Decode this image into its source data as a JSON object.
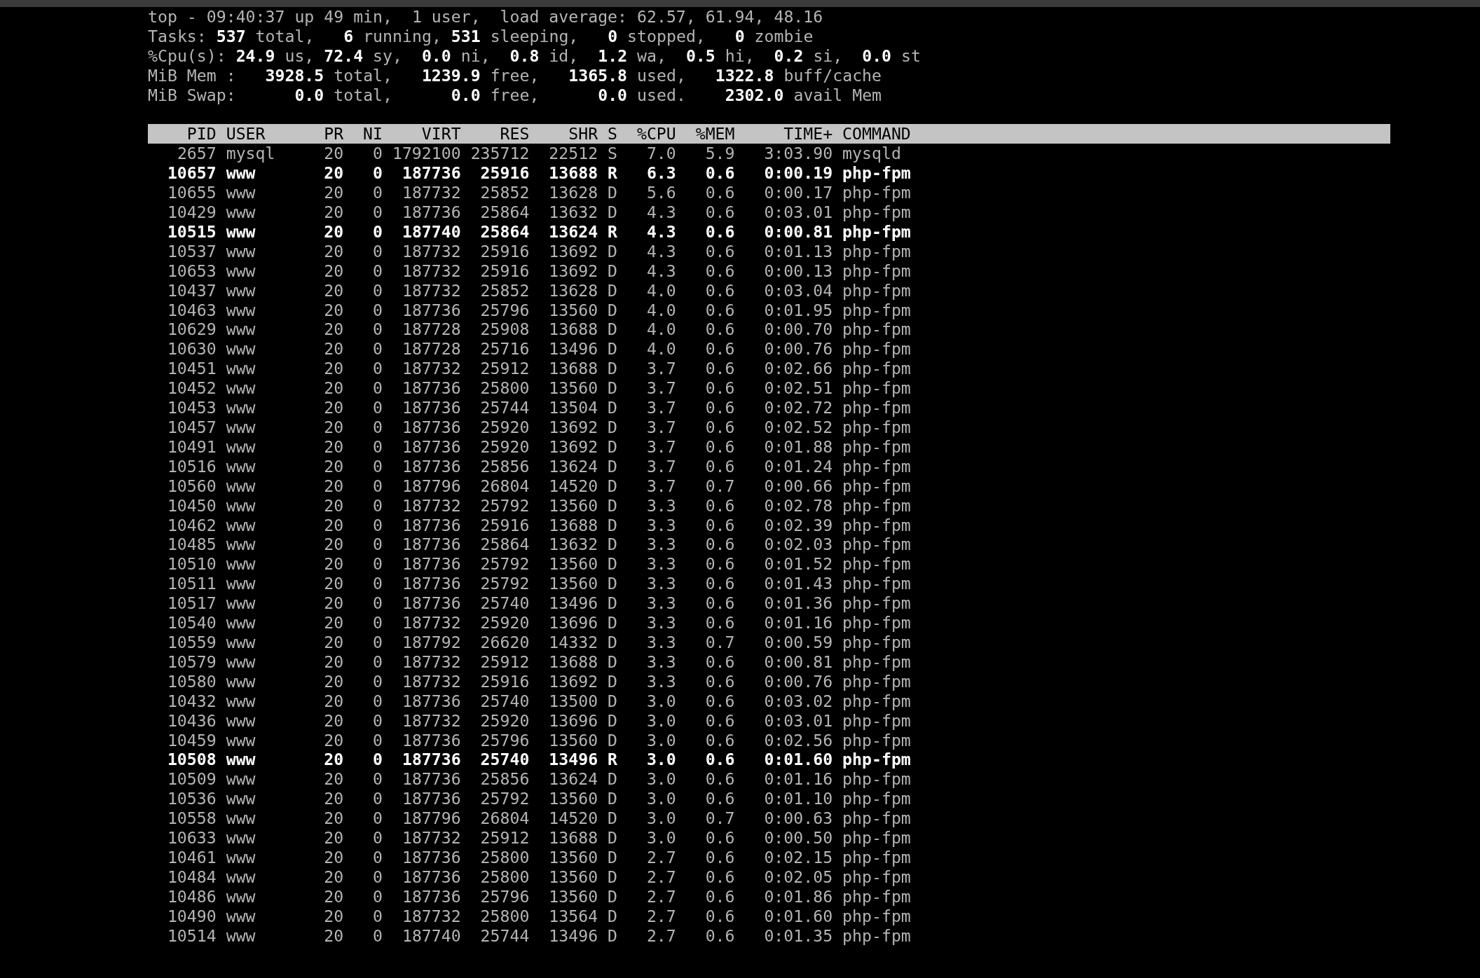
{
  "summary": [
    "top - 09:40:37 up 49 min,  1 user,  load average: 62.57, 61.94, 48.16",
    "Tasks: **537** total,   **6** running, **531** sleeping,   **0** stopped,   **0** zombie",
    "%Cpu(s): **24.9** us, **72.4** sy,  **0.0** ni,  **0.8** id,  **1.2** wa,  **0.5** hi,  **0.2** si,  **0.0** st",
    "MiB Mem :   **3928.5** total,   **1239.9** free,   **1365.8** used,   **1322.8** buff/cache",
    "MiB Swap:      **0.0** total,      **0.0** free,      **0.0** used.    **2302.0** avail Mem"
  ],
  "columns": [
    "PID",
    "USER",
    "PR",
    "NI",
    "VIRT",
    "RES",
    "SHR",
    "S",
    "%CPU",
    "%MEM",
    "TIME+",
    "COMMAND"
  ],
  "rows": [
    {
      "cells": [
        "2657",
        "mysql",
        "20",
        "0",
        "1792100",
        "235712",
        "22512",
        "S",
        "7.0",
        "5.9",
        "3:03.90",
        "mysqld"
      ],
      "running": false
    },
    {
      "cells": [
        "10657",
        "www",
        "20",
        "0",
        "187736",
        "25916",
        "13688",
        "R",
        "6.3",
        "0.6",
        "0:00.19",
        "php-fpm"
      ],
      "running": true
    },
    {
      "cells": [
        "10655",
        "www",
        "20",
        "0",
        "187732",
        "25852",
        "13628",
        "D",
        "5.6",
        "0.6",
        "0:00.17",
        "php-fpm"
      ],
      "running": false
    },
    {
      "cells": [
        "10429",
        "www",
        "20",
        "0",
        "187736",
        "25864",
        "13632",
        "D",
        "4.3",
        "0.6",
        "0:03.01",
        "php-fpm"
      ],
      "running": false
    },
    {
      "cells": [
        "10515",
        "www",
        "20",
        "0",
        "187740",
        "25864",
        "13624",
        "R",
        "4.3",
        "0.6",
        "0:00.81",
        "php-fpm"
      ],
      "running": true
    },
    {
      "cells": [
        "10537",
        "www",
        "20",
        "0",
        "187732",
        "25916",
        "13692",
        "D",
        "4.3",
        "0.6",
        "0:01.13",
        "php-fpm"
      ],
      "running": false
    },
    {
      "cells": [
        "10653",
        "www",
        "20",
        "0",
        "187732",
        "25916",
        "13692",
        "D",
        "4.3",
        "0.6",
        "0:00.13",
        "php-fpm"
      ],
      "running": false
    },
    {
      "cells": [
        "10437",
        "www",
        "20",
        "0",
        "187732",
        "25852",
        "13628",
        "D",
        "4.0",
        "0.6",
        "0:03.04",
        "php-fpm"
      ],
      "running": false
    },
    {
      "cells": [
        "10463",
        "www",
        "20",
        "0",
        "187736",
        "25796",
        "13560",
        "D",
        "4.0",
        "0.6",
        "0:01.95",
        "php-fpm"
      ],
      "running": false
    },
    {
      "cells": [
        "10629",
        "www",
        "20",
        "0",
        "187728",
        "25908",
        "13688",
        "D",
        "4.0",
        "0.6",
        "0:00.70",
        "php-fpm"
      ],
      "running": false
    },
    {
      "cells": [
        "10630",
        "www",
        "20",
        "0",
        "187728",
        "25716",
        "13496",
        "D",
        "4.0",
        "0.6",
        "0:00.76",
        "php-fpm"
      ],
      "running": false
    },
    {
      "cells": [
        "10451",
        "www",
        "20",
        "0",
        "187732",
        "25912",
        "13688",
        "D",
        "3.7",
        "0.6",
        "0:02.66",
        "php-fpm"
      ],
      "running": false
    },
    {
      "cells": [
        "10452",
        "www",
        "20",
        "0",
        "187736",
        "25800",
        "13560",
        "D",
        "3.7",
        "0.6",
        "0:02.51",
        "php-fpm"
      ],
      "running": false
    },
    {
      "cells": [
        "10453",
        "www",
        "20",
        "0",
        "187736",
        "25744",
        "13504",
        "D",
        "3.7",
        "0.6",
        "0:02.72",
        "php-fpm"
      ],
      "running": false
    },
    {
      "cells": [
        "10457",
        "www",
        "20",
        "0",
        "187736",
        "25920",
        "13692",
        "D",
        "3.7",
        "0.6",
        "0:02.52",
        "php-fpm"
      ],
      "running": false
    },
    {
      "cells": [
        "10491",
        "www",
        "20",
        "0",
        "187736",
        "25920",
        "13692",
        "D",
        "3.7",
        "0.6",
        "0:01.88",
        "php-fpm"
      ],
      "running": false
    },
    {
      "cells": [
        "10516",
        "www",
        "20",
        "0",
        "187736",
        "25856",
        "13624",
        "D",
        "3.7",
        "0.6",
        "0:01.24",
        "php-fpm"
      ],
      "running": false
    },
    {
      "cells": [
        "10560",
        "www",
        "20",
        "0",
        "187796",
        "26804",
        "14520",
        "D",
        "3.7",
        "0.7",
        "0:00.66",
        "php-fpm"
      ],
      "running": false
    },
    {
      "cells": [
        "10450",
        "www",
        "20",
        "0",
        "187732",
        "25792",
        "13560",
        "D",
        "3.3",
        "0.6",
        "0:02.78",
        "php-fpm"
      ],
      "running": false
    },
    {
      "cells": [
        "10462",
        "www",
        "20",
        "0",
        "187736",
        "25916",
        "13688",
        "D",
        "3.3",
        "0.6",
        "0:02.39",
        "php-fpm"
      ],
      "running": false
    },
    {
      "cells": [
        "10485",
        "www",
        "20",
        "0",
        "187736",
        "25864",
        "13632",
        "D",
        "3.3",
        "0.6",
        "0:02.03",
        "php-fpm"
      ],
      "running": false
    },
    {
      "cells": [
        "10510",
        "www",
        "20",
        "0",
        "187736",
        "25792",
        "13560",
        "D",
        "3.3",
        "0.6",
        "0:01.52",
        "php-fpm"
      ],
      "running": false
    },
    {
      "cells": [
        "10511",
        "www",
        "20",
        "0",
        "187736",
        "25792",
        "13560",
        "D",
        "3.3",
        "0.6",
        "0:01.43",
        "php-fpm"
      ],
      "running": false
    },
    {
      "cells": [
        "10517",
        "www",
        "20",
        "0",
        "187736",
        "25740",
        "13496",
        "D",
        "3.3",
        "0.6",
        "0:01.36",
        "php-fpm"
      ],
      "running": false
    },
    {
      "cells": [
        "10540",
        "www",
        "20",
        "0",
        "187732",
        "25920",
        "13696",
        "D",
        "3.3",
        "0.6",
        "0:01.16",
        "php-fpm"
      ],
      "running": false
    },
    {
      "cells": [
        "10559",
        "www",
        "20",
        "0",
        "187792",
        "26620",
        "14332",
        "D",
        "3.3",
        "0.7",
        "0:00.59",
        "php-fpm"
      ],
      "running": false
    },
    {
      "cells": [
        "10579",
        "www",
        "20",
        "0",
        "187732",
        "25912",
        "13688",
        "D",
        "3.3",
        "0.6",
        "0:00.81",
        "php-fpm"
      ],
      "running": false
    },
    {
      "cells": [
        "10580",
        "www",
        "20",
        "0",
        "187732",
        "25916",
        "13692",
        "D",
        "3.3",
        "0.6",
        "0:00.76",
        "php-fpm"
      ],
      "running": false
    },
    {
      "cells": [
        "10432",
        "www",
        "20",
        "0",
        "187736",
        "25740",
        "13500",
        "D",
        "3.0",
        "0.6",
        "0:03.02",
        "php-fpm"
      ],
      "running": false
    },
    {
      "cells": [
        "10436",
        "www",
        "20",
        "0",
        "187732",
        "25920",
        "13696",
        "D",
        "3.0",
        "0.6",
        "0:03.01",
        "php-fpm"
      ],
      "running": false
    },
    {
      "cells": [
        "10459",
        "www",
        "20",
        "0",
        "187736",
        "25796",
        "13560",
        "D",
        "3.0",
        "0.6",
        "0:02.56",
        "php-fpm"
      ],
      "running": false
    },
    {
      "cells": [
        "10508",
        "www",
        "20",
        "0",
        "187736",
        "25740",
        "13496",
        "R",
        "3.0",
        "0.6",
        "0:01.60",
        "php-fpm"
      ],
      "running": true
    },
    {
      "cells": [
        "10509",
        "www",
        "20",
        "0",
        "187736",
        "25856",
        "13624",
        "D",
        "3.0",
        "0.6",
        "0:01.16",
        "php-fpm"
      ],
      "running": false
    },
    {
      "cells": [
        "10536",
        "www",
        "20",
        "0",
        "187736",
        "25792",
        "13560",
        "D",
        "3.0",
        "0.6",
        "0:01.10",
        "php-fpm"
      ],
      "running": false
    },
    {
      "cells": [
        "10558",
        "www",
        "20",
        "0",
        "187796",
        "26804",
        "14520",
        "D",
        "3.0",
        "0.7",
        "0:00.63",
        "php-fpm"
      ],
      "running": false
    },
    {
      "cells": [
        "10633",
        "www",
        "20",
        "0",
        "187732",
        "25912",
        "13688",
        "D",
        "3.0",
        "0.6",
        "0:00.50",
        "php-fpm"
      ],
      "running": false
    },
    {
      "cells": [
        "10461",
        "www",
        "20",
        "0",
        "187736",
        "25800",
        "13560",
        "D",
        "2.7",
        "0.6",
        "0:02.15",
        "php-fpm"
      ],
      "running": false
    },
    {
      "cells": [
        "10484",
        "www",
        "20",
        "0",
        "187736",
        "25800",
        "13560",
        "D",
        "2.7",
        "0.6",
        "0:02.05",
        "php-fpm"
      ],
      "running": false
    },
    {
      "cells": [
        "10486",
        "www",
        "20",
        "0",
        "187736",
        "25796",
        "13560",
        "D",
        "2.7",
        "0.6",
        "0:01.86",
        "php-fpm"
      ],
      "running": false
    },
    {
      "cells": [
        "10490",
        "www",
        "20",
        "0",
        "187732",
        "25800",
        "13564",
        "D",
        "2.7",
        "0.6",
        "0:01.60",
        "php-fpm"
      ],
      "running": false
    },
    {
      "cells": [
        "10514",
        "www",
        "20",
        "0",
        "187740",
        "25744",
        "13496",
        "D",
        "2.7",
        "0.6",
        "0:01.35",
        "php-fpm"
      ],
      "running": false
    }
  ]
}
